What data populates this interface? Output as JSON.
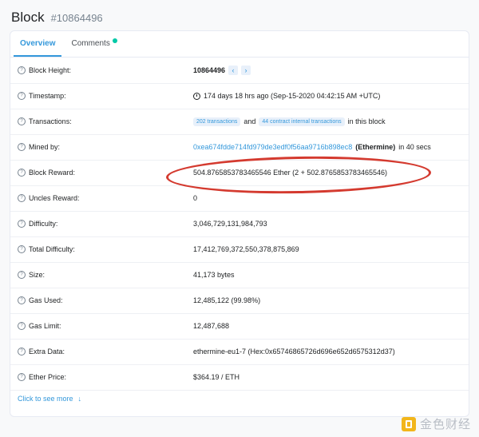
{
  "header": {
    "title": "Block",
    "block_id": "#10864496"
  },
  "tabs": [
    {
      "label": "Overview",
      "active": true
    },
    {
      "label": "Comments",
      "active": false
    }
  ],
  "rows": {
    "block_height": {
      "label": "Block Height:",
      "value": "10864496",
      "prev_icon": "‹",
      "next_icon": "›"
    },
    "timestamp": {
      "label": "Timestamp:",
      "value": "174 days 18 hrs ago (Sep-15-2020 04:42:15 AM +UTC)",
      "icon": "clock-icon"
    },
    "transactions": {
      "label": "Transactions:",
      "badge1": "202 transactions",
      "and": "and",
      "badge2": "44 contract internal transactions",
      "suffix": "in this block"
    },
    "mined_by": {
      "label": "Mined by:",
      "address": "0xea674fdde714fd979de3edf0f56aa9716b898ec8",
      "miner": "(Ethermine)",
      "suffix": "in 40 secs"
    },
    "block_reward": {
      "label": "Block Reward:",
      "value": "504.8765853783465546 Ether (2 + 502.8765853783465546)"
    },
    "uncles_reward": {
      "label": "Uncles Reward:",
      "value": "0"
    },
    "difficulty": {
      "label": "Difficulty:",
      "value": "3,046,729,131,984,793"
    },
    "total_difficulty": {
      "label": "Total Difficulty:",
      "value": "17,412,769,372,550,378,875,869"
    },
    "size": {
      "label": "Size:",
      "value": "41,173 bytes"
    },
    "gas_used": {
      "label": "Gas Used:",
      "value": "12,485,122 (99.98%)"
    },
    "gas_limit": {
      "label": "Gas Limit:",
      "value": "12,487,688"
    },
    "extra_data": {
      "label": "Extra Data:",
      "value": "ethermine-eu1-7 (Hex:0x65746865726d696e652d6575312d37)"
    },
    "ether_price": {
      "label": "Ether Price:",
      "value": "$364.19 / ETH"
    }
  },
  "help_icon": "?",
  "footer": {
    "more_label": "Click to see more",
    "arrow": "↓"
  },
  "watermark": {
    "text": "金色财经"
  },
  "colors": {
    "accent": "#3498db",
    "annotation": "#d43a2f",
    "badge_bg": "#e8f0fa",
    "comment_dot": "#00c9a7",
    "watermark_logo": "#f2b61b"
  }
}
